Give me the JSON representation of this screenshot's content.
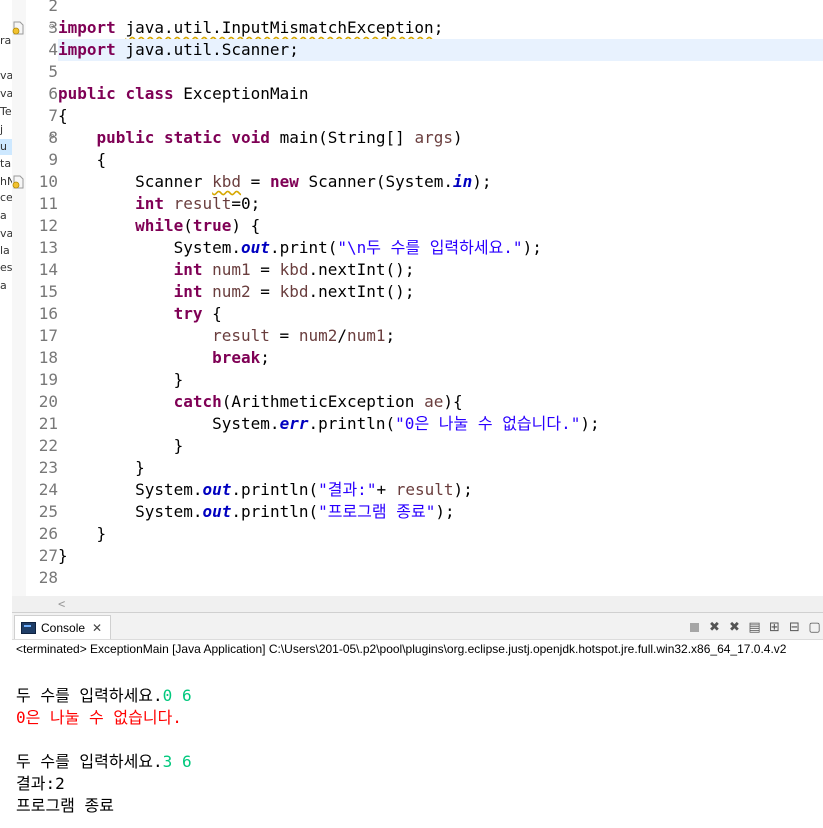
{
  "left_panel": {
    "fragments": [
      "ra",
      "va",
      "va",
      "Te",
      "j",
      "u",
      "ta",
      "hN",
      "ce",
      "a",
      "va",
      "la",
      "es",
      "a"
    ]
  },
  "editor": {
    "lines": [
      {
        "n": "2",
        "tokens": []
      },
      {
        "n": "3",
        "fold": "⊖",
        "marker": "warning",
        "tokens": [
          {
            "t": "import",
            "c": "kw"
          },
          {
            "t": " "
          },
          {
            "t": "java.util.InputMismatchException",
            "c": "warn"
          },
          {
            "t": ";"
          }
        ]
      },
      {
        "n": "4",
        "current": true,
        "tokens": [
          {
            "t": "import",
            "c": "kw"
          },
          {
            "t": " java.util.Scanner;"
          }
        ]
      },
      {
        "n": "5",
        "tokens": []
      },
      {
        "n": "6",
        "tokens": [
          {
            "t": "public",
            "c": "kw"
          },
          {
            "t": " "
          },
          {
            "t": "class",
            "c": "kw"
          },
          {
            "t": " ExceptionMain"
          }
        ]
      },
      {
        "n": "7",
        "tokens": [
          {
            "t": "{"
          }
        ]
      },
      {
        "n": "8",
        "fold": "⊖",
        "tokens": [
          {
            "t": "    "
          },
          {
            "t": "public",
            "c": "kw"
          },
          {
            "t": " "
          },
          {
            "t": "static",
            "c": "kw"
          },
          {
            "t": " "
          },
          {
            "t": "void",
            "c": "kw"
          },
          {
            "t": " main(String[] "
          },
          {
            "t": "args",
            "c": "loc"
          },
          {
            "t": ")"
          }
        ]
      },
      {
        "n": "9",
        "tokens": [
          {
            "t": "    {"
          }
        ]
      },
      {
        "n": "10",
        "marker": "warning",
        "tokens": [
          {
            "t": "        Scanner "
          },
          {
            "t": "kbd",
            "c": "warn loc"
          },
          {
            "t": " = "
          },
          {
            "t": "new",
            "c": "kw"
          },
          {
            "t": " Scanner(System."
          },
          {
            "t": "in",
            "c": "fld"
          },
          {
            "t": ");"
          }
        ]
      },
      {
        "n": "11",
        "tokens": [
          {
            "t": "        "
          },
          {
            "t": "int",
            "c": "kw"
          },
          {
            "t": " "
          },
          {
            "t": "result",
            "c": "loc"
          },
          {
            "t": "=0;"
          }
        ]
      },
      {
        "n": "12",
        "tokens": [
          {
            "t": "        "
          },
          {
            "t": "while",
            "c": "kw"
          },
          {
            "t": "("
          },
          {
            "t": "true",
            "c": "kw"
          },
          {
            "t": ") {"
          }
        ]
      },
      {
        "n": "13",
        "tokens": [
          {
            "t": "            System."
          },
          {
            "t": "out",
            "c": "fld"
          },
          {
            "t": ".print("
          },
          {
            "t": "\"\\n두 수를 입력하세요.\"",
            "c": "str"
          },
          {
            "t": ");"
          }
        ]
      },
      {
        "n": "14",
        "tokens": [
          {
            "t": "            "
          },
          {
            "t": "int",
            "c": "kw"
          },
          {
            "t": " "
          },
          {
            "t": "num1",
            "c": "loc"
          },
          {
            "t": " = "
          },
          {
            "t": "kbd",
            "c": "loc"
          },
          {
            "t": ".nextInt();"
          }
        ]
      },
      {
        "n": "15",
        "tokens": [
          {
            "t": "            "
          },
          {
            "t": "int",
            "c": "kw"
          },
          {
            "t": " "
          },
          {
            "t": "num2",
            "c": "loc"
          },
          {
            "t": " = "
          },
          {
            "t": "kbd",
            "c": "loc"
          },
          {
            "t": ".nextInt();"
          }
        ]
      },
      {
        "n": "16",
        "tokens": [
          {
            "t": "            "
          },
          {
            "t": "try",
            "c": "kw"
          },
          {
            "t": " {"
          }
        ]
      },
      {
        "n": "17",
        "tokens": [
          {
            "t": "                "
          },
          {
            "t": "result",
            "c": "loc"
          },
          {
            "t": " = "
          },
          {
            "t": "num2",
            "c": "loc"
          },
          {
            "t": "/"
          },
          {
            "t": "num1",
            "c": "loc"
          },
          {
            "t": ";"
          }
        ]
      },
      {
        "n": "18",
        "tokens": [
          {
            "t": "                "
          },
          {
            "t": "break",
            "c": "kw"
          },
          {
            "t": ";"
          }
        ]
      },
      {
        "n": "19",
        "tokens": [
          {
            "t": "            }"
          }
        ]
      },
      {
        "n": "20",
        "tokens": [
          {
            "t": "            "
          },
          {
            "t": "catch",
            "c": "kw"
          },
          {
            "t": "(ArithmeticException "
          },
          {
            "t": "ae",
            "c": "loc"
          },
          {
            "t": "){"
          }
        ]
      },
      {
        "n": "21",
        "tokens": [
          {
            "t": "                System."
          },
          {
            "t": "err",
            "c": "fld"
          },
          {
            "t": ".println("
          },
          {
            "t": "\"0은 나눌 수 없습니다.\"",
            "c": "str"
          },
          {
            "t": ");"
          }
        ]
      },
      {
        "n": "22",
        "tokens": [
          {
            "t": "            }"
          }
        ]
      },
      {
        "n": "23",
        "tokens": [
          {
            "t": "        }"
          }
        ]
      },
      {
        "n": "24",
        "tokens": [
          {
            "t": "        System."
          },
          {
            "t": "out",
            "c": "fld"
          },
          {
            "t": ".println("
          },
          {
            "t": "\"결과:\"",
            "c": "str"
          },
          {
            "t": "+ "
          },
          {
            "t": "result",
            "c": "loc"
          },
          {
            "t": ");"
          }
        ]
      },
      {
        "n": "25",
        "tokens": [
          {
            "t": "        System."
          },
          {
            "t": "out",
            "c": "fld"
          },
          {
            "t": ".println("
          },
          {
            "t": "\"프로그램 종료\"",
            "c": "str"
          },
          {
            "t": ");"
          }
        ]
      },
      {
        "n": "26",
        "tokens": [
          {
            "t": "    }"
          }
        ]
      },
      {
        "n": "27",
        "tokens": [
          {
            "t": "}"
          }
        ]
      },
      {
        "n": "28",
        "tokens": []
      }
    ],
    "scroll_left_glyph": "<"
  },
  "console": {
    "tab_label": "Console",
    "tab_close": "✕",
    "description": "<terminated> ExceptionMain [Java Application] C:\\Users\\201-05\\.p2\\pool\\plugins\\org.eclipse.justj.openjdk.hotspot.jre.full.win32.x86_64_17.0.4.v2",
    "toolbar": [
      {
        "name": "terminate-icon",
        "glyph": ""
      },
      {
        "name": "remove-launch-icon",
        "glyph": "✖"
      },
      {
        "name": "remove-all-icon",
        "glyph": "✖"
      },
      {
        "name": "clear-console-icon",
        "glyph": "▤"
      },
      {
        "name": "scroll-lock-icon",
        "glyph": "⊞"
      },
      {
        "name": "pin-console-icon",
        "glyph": "⊟"
      },
      {
        "name": "display-console-icon",
        "glyph": "▢"
      }
    ],
    "output": [
      {
        "segments": []
      },
      {
        "segments": [
          {
            "t": "두 수를 입력하세요.",
            "c": "normal"
          },
          {
            "t": "0 6",
            "c": "in"
          }
        ]
      },
      {
        "segments": [
          {
            "t": "0은 나눌 수 없습니다.",
            "c": "err"
          }
        ]
      },
      {
        "segments": []
      },
      {
        "segments": [
          {
            "t": "두 수를 입력하세요.",
            "c": "normal"
          },
          {
            "t": "3 6",
            "c": "in"
          }
        ]
      },
      {
        "segments": [
          {
            "t": "결과:2",
            "c": "normal"
          }
        ]
      },
      {
        "segments": [
          {
            "t": "프로그램 종료",
            "c": "normal"
          }
        ]
      }
    ]
  },
  "colors": {
    "keyword": "#7f0055",
    "string": "#2a00ff",
    "static_field": "#0000c0",
    "console_error": "#ff0000",
    "console_input": "#00c87d",
    "current_line": "#e8f2fe"
  }
}
